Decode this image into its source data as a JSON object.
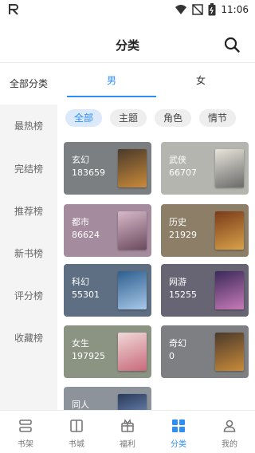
{
  "status": {
    "time": "11:06"
  },
  "header": {
    "title": "分类"
  },
  "sidebar": {
    "items": [
      {
        "label": "全部分类",
        "active": true
      },
      {
        "label": "最热榜"
      },
      {
        "label": "完结榜"
      },
      {
        "label": "推荐榜"
      },
      {
        "label": "新书榜"
      },
      {
        "label": "评分榜"
      },
      {
        "label": "收藏榜"
      }
    ]
  },
  "tabs": [
    {
      "label": "男",
      "active": true
    },
    {
      "label": "女"
    }
  ],
  "chips": [
    {
      "label": "全部",
      "active": true
    },
    {
      "label": "主题"
    },
    {
      "label": "角色"
    },
    {
      "label": "情节"
    }
  ],
  "categories": [
    {
      "name": "玄幻",
      "count": "183659",
      "bg": "#7c7f81",
      "cover": [
        "#4a3a2a",
        "#c98a3a"
      ]
    },
    {
      "name": "武侠",
      "count": "66707",
      "bg": "#b4b5ae",
      "cover": [
        "#e8e4da",
        "#6a6a6a"
      ]
    },
    {
      "name": "都市",
      "count": "86624",
      "bg": "#a48b9d",
      "cover": [
        "#d7b9c9",
        "#6b4a5e"
      ]
    },
    {
      "name": "历史",
      "count": "21929",
      "bg": "#8c7e67",
      "cover": [
        "#7a3a1a",
        "#d8a24a"
      ]
    },
    {
      "name": "科幻",
      "count": "55301",
      "bg": "#5f6f83",
      "cover": [
        "#2f5f8f",
        "#a8c8e8"
      ]
    },
    {
      "name": "网游",
      "count": "15255",
      "bg": "#676473",
      "cover": [
        "#3a2a5a",
        "#c87ab8"
      ]
    },
    {
      "name": "女生",
      "count": "197925",
      "bg": "#8b9383",
      "cover": [
        "#f0d8d8",
        "#c86a7a"
      ]
    },
    {
      "name": "奇幻",
      "count": "0",
      "bg": "#7e7f82",
      "cover": [
        "#4a3a2a",
        "#c98a3a"
      ]
    },
    {
      "name": "同人",
      "count": "",
      "bg": "#8d939b",
      "cover": [
        "#2a3a5a",
        "#8aa8d8"
      ]
    }
  ],
  "bottom_nav": [
    {
      "label": "书架",
      "icon": "bookshelf-icon"
    },
    {
      "label": "书城",
      "icon": "book-icon"
    },
    {
      "label": "福利",
      "icon": "gift-icon"
    },
    {
      "label": "分类",
      "icon": "category-grid-icon",
      "active": true
    },
    {
      "label": "我的",
      "icon": "profile-icon"
    }
  ],
  "colors": {
    "accent": "#2f8ef5"
  }
}
